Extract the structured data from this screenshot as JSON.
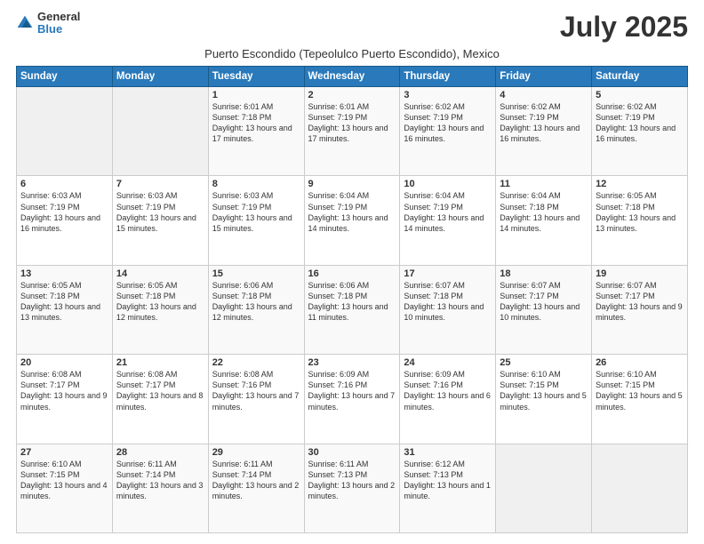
{
  "header": {
    "logo_line1": "General",
    "logo_line2": "Blue",
    "month_title": "July 2025",
    "subtitle": "Puerto Escondido (Tepeolulco Puerto Escondido), Mexico"
  },
  "weekdays": [
    "Sunday",
    "Monday",
    "Tuesday",
    "Wednesday",
    "Thursday",
    "Friday",
    "Saturday"
  ],
  "weeks": [
    [
      {
        "day": "",
        "info": ""
      },
      {
        "day": "",
        "info": ""
      },
      {
        "day": "1",
        "info": "Sunrise: 6:01 AM\nSunset: 7:18 PM\nDaylight: 13 hours and 17 minutes."
      },
      {
        "day": "2",
        "info": "Sunrise: 6:01 AM\nSunset: 7:19 PM\nDaylight: 13 hours and 17 minutes."
      },
      {
        "day": "3",
        "info": "Sunrise: 6:02 AM\nSunset: 7:19 PM\nDaylight: 13 hours and 16 minutes."
      },
      {
        "day": "4",
        "info": "Sunrise: 6:02 AM\nSunset: 7:19 PM\nDaylight: 13 hours and 16 minutes."
      },
      {
        "day": "5",
        "info": "Sunrise: 6:02 AM\nSunset: 7:19 PM\nDaylight: 13 hours and 16 minutes."
      }
    ],
    [
      {
        "day": "6",
        "info": "Sunrise: 6:03 AM\nSunset: 7:19 PM\nDaylight: 13 hours and 16 minutes."
      },
      {
        "day": "7",
        "info": "Sunrise: 6:03 AM\nSunset: 7:19 PM\nDaylight: 13 hours and 15 minutes."
      },
      {
        "day": "8",
        "info": "Sunrise: 6:03 AM\nSunset: 7:19 PM\nDaylight: 13 hours and 15 minutes."
      },
      {
        "day": "9",
        "info": "Sunrise: 6:04 AM\nSunset: 7:19 PM\nDaylight: 13 hours and 14 minutes."
      },
      {
        "day": "10",
        "info": "Sunrise: 6:04 AM\nSunset: 7:19 PM\nDaylight: 13 hours and 14 minutes."
      },
      {
        "day": "11",
        "info": "Sunrise: 6:04 AM\nSunset: 7:18 PM\nDaylight: 13 hours and 14 minutes."
      },
      {
        "day": "12",
        "info": "Sunrise: 6:05 AM\nSunset: 7:18 PM\nDaylight: 13 hours and 13 minutes."
      }
    ],
    [
      {
        "day": "13",
        "info": "Sunrise: 6:05 AM\nSunset: 7:18 PM\nDaylight: 13 hours and 13 minutes."
      },
      {
        "day": "14",
        "info": "Sunrise: 6:05 AM\nSunset: 7:18 PM\nDaylight: 13 hours and 12 minutes."
      },
      {
        "day": "15",
        "info": "Sunrise: 6:06 AM\nSunset: 7:18 PM\nDaylight: 13 hours and 12 minutes."
      },
      {
        "day": "16",
        "info": "Sunrise: 6:06 AM\nSunset: 7:18 PM\nDaylight: 13 hours and 11 minutes."
      },
      {
        "day": "17",
        "info": "Sunrise: 6:07 AM\nSunset: 7:18 PM\nDaylight: 13 hours and 10 minutes."
      },
      {
        "day": "18",
        "info": "Sunrise: 6:07 AM\nSunset: 7:17 PM\nDaylight: 13 hours and 10 minutes."
      },
      {
        "day": "19",
        "info": "Sunrise: 6:07 AM\nSunset: 7:17 PM\nDaylight: 13 hours and 9 minutes."
      }
    ],
    [
      {
        "day": "20",
        "info": "Sunrise: 6:08 AM\nSunset: 7:17 PM\nDaylight: 13 hours and 9 minutes."
      },
      {
        "day": "21",
        "info": "Sunrise: 6:08 AM\nSunset: 7:17 PM\nDaylight: 13 hours and 8 minutes."
      },
      {
        "day": "22",
        "info": "Sunrise: 6:08 AM\nSunset: 7:16 PM\nDaylight: 13 hours and 7 minutes."
      },
      {
        "day": "23",
        "info": "Sunrise: 6:09 AM\nSunset: 7:16 PM\nDaylight: 13 hours and 7 minutes."
      },
      {
        "day": "24",
        "info": "Sunrise: 6:09 AM\nSunset: 7:16 PM\nDaylight: 13 hours and 6 minutes."
      },
      {
        "day": "25",
        "info": "Sunrise: 6:10 AM\nSunset: 7:15 PM\nDaylight: 13 hours and 5 minutes."
      },
      {
        "day": "26",
        "info": "Sunrise: 6:10 AM\nSunset: 7:15 PM\nDaylight: 13 hours and 5 minutes."
      }
    ],
    [
      {
        "day": "27",
        "info": "Sunrise: 6:10 AM\nSunset: 7:15 PM\nDaylight: 13 hours and 4 minutes."
      },
      {
        "day": "28",
        "info": "Sunrise: 6:11 AM\nSunset: 7:14 PM\nDaylight: 13 hours and 3 minutes."
      },
      {
        "day": "29",
        "info": "Sunrise: 6:11 AM\nSunset: 7:14 PM\nDaylight: 13 hours and 2 minutes."
      },
      {
        "day": "30",
        "info": "Sunrise: 6:11 AM\nSunset: 7:13 PM\nDaylight: 13 hours and 2 minutes."
      },
      {
        "day": "31",
        "info": "Sunrise: 6:12 AM\nSunset: 7:13 PM\nDaylight: 13 hours and 1 minute."
      },
      {
        "day": "",
        "info": ""
      },
      {
        "day": "",
        "info": ""
      }
    ]
  ]
}
